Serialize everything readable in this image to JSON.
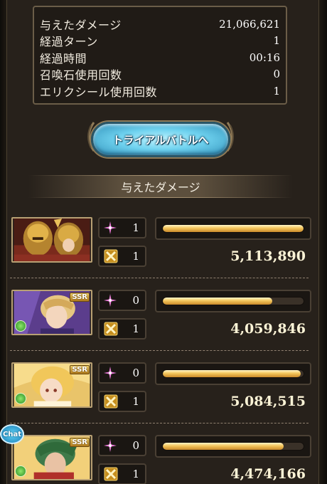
{
  "summary": {
    "rows": [
      {
        "label": "与えたダメージ",
        "value": "21,066,621"
      },
      {
        "label": "経過ターン",
        "value": "1"
      },
      {
        "label": "経過時間",
        "value": "00:16"
      },
      {
        "label": "召喚石使用回数",
        "value": "0"
      },
      {
        "label": "エリクシール使用回数",
        "value": "1"
      }
    ]
  },
  "trial_button": {
    "label": "トライアルバトルへ"
  },
  "section": {
    "title": "与えたダメージ"
  },
  "characters": [
    {
      "rarity_badge": "",
      "ougi_count": "1",
      "skill_count": "1",
      "damage": "5,113,890",
      "gauge_fraction": 1.0
    },
    {
      "rarity_badge": "SSR",
      "ougi_count": "0",
      "skill_count": "1",
      "damage": "4,059,846",
      "gauge_fraction": 0.78
    },
    {
      "rarity_badge": "SSR",
      "ougi_count": "0",
      "skill_count": "1",
      "damage": "5,084,515",
      "gauge_fraction": 0.98
    },
    {
      "rarity_badge": "SSR",
      "ougi_count": "0",
      "skill_count": "1",
      "damage": "4,474,166",
      "gauge_fraction": 0.86
    }
  ],
  "chat_button": {
    "label": "Chat"
  },
  "colors": {
    "gauge": "#f4c65c",
    "button": "#6fd2ef",
    "background": "#27211b"
  }
}
